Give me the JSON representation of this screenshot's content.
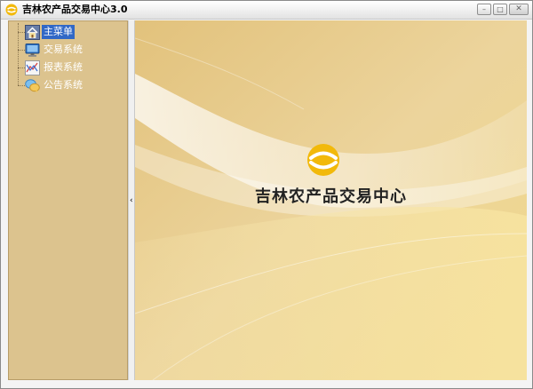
{
  "window": {
    "title": "吉林农产品交易中心3.0",
    "minimize_glyph": "–",
    "maximize_glyph": "□",
    "close_glyph": "✕"
  },
  "sidebar": {
    "items": [
      {
        "label": "主菜单",
        "icon": "home-icon",
        "selected": true
      },
      {
        "label": "交易系统",
        "icon": "monitor-icon",
        "selected": false
      },
      {
        "label": "报表系统",
        "icon": "chart-icon",
        "selected": false
      },
      {
        "label": "公告系统",
        "icon": "chat-bubble-icon",
        "selected": false
      }
    ]
  },
  "splitter": {
    "arrow_glyph": "‹"
  },
  "main": {
    "brand_title": "吉林农产品交易中心"
  },
  "colors": {
    "sidebar_bg": "#dcc38e",
    "main_bg": "#e5c884",
    "selection": "#3168c6",
    "logo_yellow": "#f2b90a"
  }
}
